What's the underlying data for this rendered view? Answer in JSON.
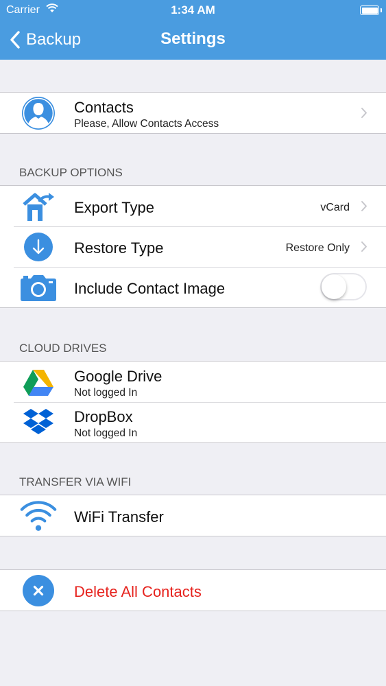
{
  "status_bar": {
    "carrier": "Carrier",
    "time": "1:34 AM"
  },
  "nav": {
    "back_label": "Backup",
    "title": "Settings"
  },
  "contacts": {
    "title": "Contacts",
    "subtitle": "Please, Allow Contacts Access",
    "icon": "contact-person-icon"
  },
  "backup_options": {
    "header": "BACKUP OPTIONS",
    "export": {
      "title": "Export Type",
      "value": "vCard",
      "icon": "export-house-icon"
    },
    "restore": {
      "title": "Restore Type",
      "value": "Restore Only",
      "icon": "download-arrow-icon"
    },
    "image": {
      "title": "Include Contact Image",
      "toggle_on": false,
      "icon": "camera-icon"
    }
  },
  "cloud_drives": {
    "header": "CLOUD DRIVES",
    "google": {
      "title": "Google Drive",
      "subtitle": "Not logged In",
      "icon": "google-drive-icon"
    },
    "dropbox": {
      "title": "DropBox",
      "subtitle": "Not logged In",
      "icon": "dropbox-icon"
    }
  },
  "wifi": {
    "header": "TRANSFER VIA WIFI",
    "title": "WiFi Transfer",
    "icon": "wifi-icon"
  },
  "delete": {
    "title": "Delete All Contacts",
    "icon": "delete-x-icon"
  },
  "colors": {
    "nav": "#4a9ce0",
    "icon_blue": "#3b8fe0",
    "danger": "#e6231e",
    "background": "#efeff4"
  }
}
